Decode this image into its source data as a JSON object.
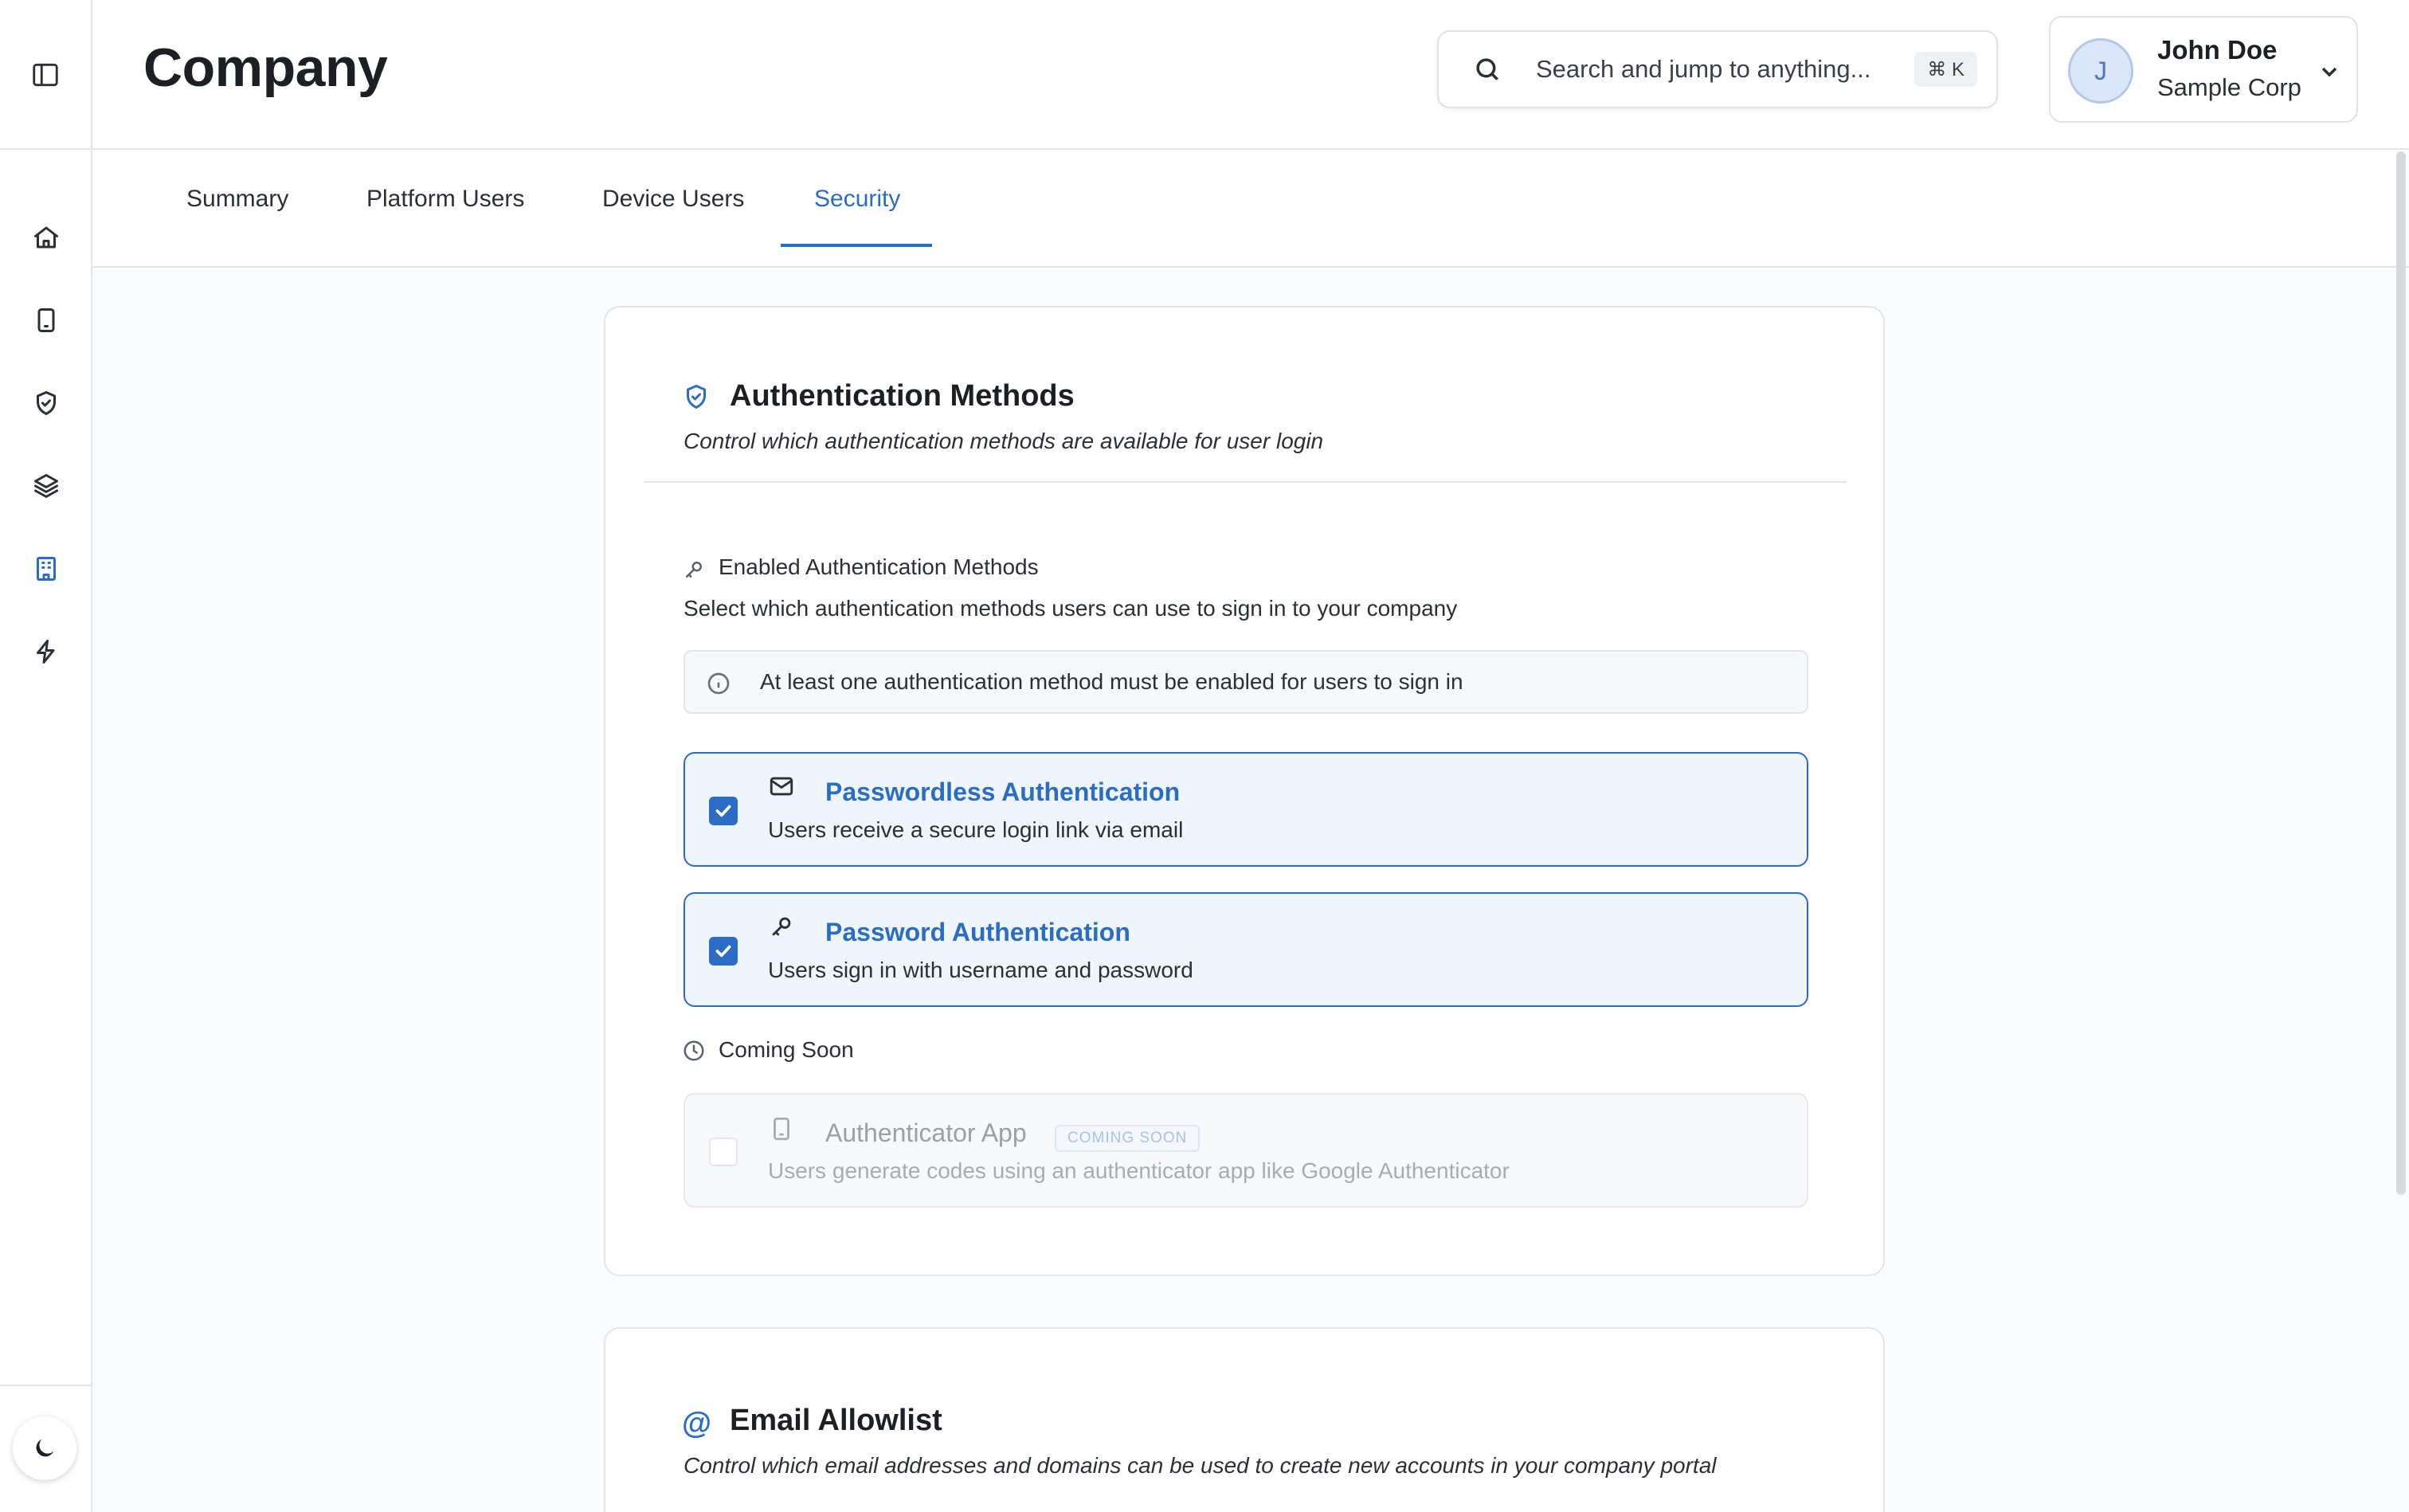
{
  "header": {
    "title": "Company",
    "search_placeholder": "Search and jump to anything...",
    "search_shortcut": "⌘ K"
  },
  "user": {
    "initial": "J",
    "name": "John Doe",
    "org": "Sample Corp"
  },
  "sidebar": {
    "items": [
      {
        "icon": "home-icon"
      },
      {
        "icon": "device-icon"
      },
      {
        "icon": "shield-check-icon"
      },
      {
        "icon": "layers-icon"
      },
      {
        "icon": "building-icon",
        "active": true
      },
      {
        "icon": "lightning-icon"
      }
    ],
    "theme_icon": "moon-icon"
  },
  "tabs": [
    {
      "label": "Summary"
    },
    {
      "label": "Platform Users"
    },
    {
      "label": "Device Users"
    },
    {
      "label": "Security",
      "active": true
    }
  ],
  "auth": {
    "title": "Authentication Methods",
    "subtitle": "Control which authentication methods are available for user login",
    "enabled_label": "Enabled Authentication Methods",
    "enabled_help": "Select which authentication methods users can use to sign in to your company",
    "info": "At least one authentication method must be enabled for users to sign in",
    "methods": [
      {
        "title": "Passwordless Authentication",
        "desc": "Users receive a secure login link via email",
        "checked": true
      },
      {
        "title": "Password Authentication",
        "desc": "Users sign in with username and password",
        "checked": true
      }
    ],
    "coming_soon_label": "Coming Soon",
    "coming": {
      "title": "Authenticator App",
      "badge": "COMING SOON",
      "desc": "Users generate codes using an authenticator app like Google Authenticator",
      "checked": false
    }
  },
  "allowlist": {
    "title": "Email Allowlist",
    "subtitle": "Control which email addresses and domains can be used to create new accounts in your company portal"
  },
  "colors": {
    "accent": "#2b6cc4",
    "border": "#e2e5e9",
    "selected_bg": "#eff5fc"
  }
}
